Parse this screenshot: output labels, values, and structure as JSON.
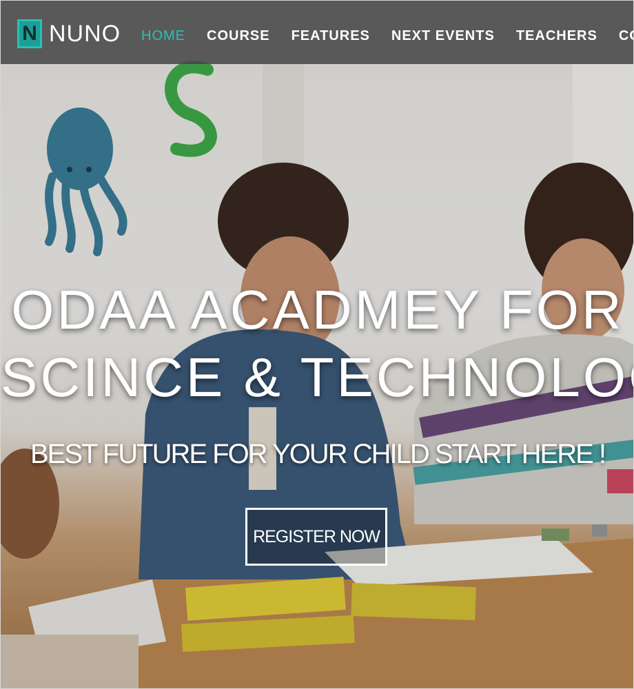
{
  "brand": {
    "logo_letter": "N",
    "name": "NUNO",
    "accent_color": "#27c1b6"
  },
  "nav": {
    "items": [
      {
        "label": "HOME",
        "active": true
      },
      {
        "label": "COURSE",
        "active": false
      },
      {
        "label": "FEATURES",
        "active": false
      },
      {
        "label": "NEXT EVENTS",
        "active": false
      },
      {
        "label": "TEACHERS",
        "active": false
      },
      {
        "label": "CONTACT",
        "active": false
      }
    ]
  },
  "hero": {
    "title_line1": "ODAA ACADMEY FOR",
    "title_line2": "SCINCE & TECHNOLOGY",
    "subtitle": "BEST FUTURE FOR YOUR CHILD START HERE !",
    "register_button": "REGISTER NOW",
    "background_image": "classroom-children-drawing-photo"
  }
}
